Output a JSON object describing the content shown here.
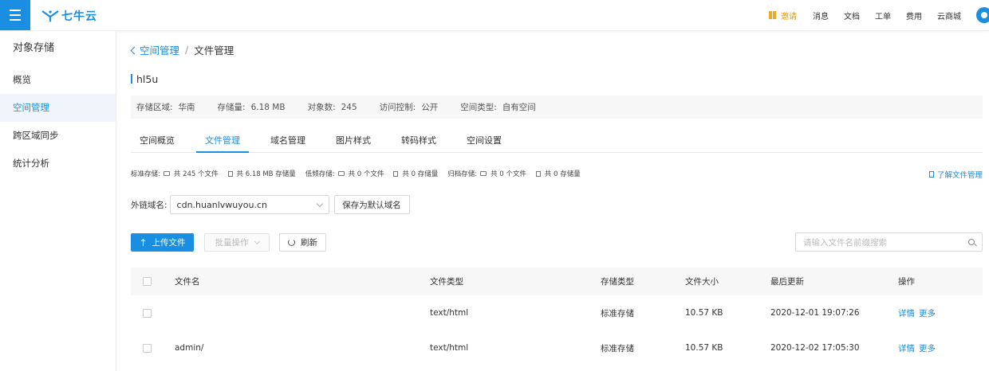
{
  "brand": {
    "logo_text": "七牛云",
    "accent": "#1a8ee0"
  },
  "topnav": {
    "invite": "邀请",
    "items": [
      "消息",
      "文档",
      "工单",
      "费用",
      "云商城"
    ]
  },
  "sidebar": {
    "title": "对象存储",
    "items": [
      {
        "label": "概览",
        "active": false
      },
      {
        "label": "空间管理",
        "active": true
      },
      {
        "label": "跨区域同步",
        "active": false
      },
      {
        "label": "统计分析",
        "active": false
      }
    ]
  },
  "breadcrumb": {
    "back": "空间管理",
    "separator": "/",
    "current": "文件管理"
  },
  "bucket": {
    "name": "hl5u",
    "info": [
      {
        "key": "存储区域:",
        "value": "华南"
      },
      {
        "key": "存储量:",
        "value": "6.18 MB"
      },
      {
        "key": "对象数:",
        "value": "245"
      },
      {
        "key": "访问控制:",
        "value": "公开"
      },
      {
        "key": "空间类型:",
        "value": "自有空间"
      }
    ]
  },
  "tabs": [
    "空间概览",
    "文件管理",
    "域名管理",
    "图片样式",
    "转码样式",
    "空间设置"
  ],
  "active_tab": "文件管理",
  "stats": [
    {
      "label": "标准存储:",
      "files": "共 245 个文件",
      "size": "共 6.18 MB 存储量"
    },
    {
      "label": "低频存储:",
      "files": "共 0 个文件",
      "size": "共 0 存储量"
    },
    {
      "label": "归档存储:",
      "files": "共 0 个文件",
      "size": "共 0 存储量"
    }
  ],
  "help_link": "了解文件管理",
  "domain": {
    "label": "外链域名:",
    "value": "cdn.huanlvwuyou.cn",
    "save_label": "保存为默认域名"
  },
  "toolbar": {
    "upload": "上传文件",
    "batch": "批量操作",
    "refresh": "刷新"
  },
  "search": {
    "placeholder": "请输入文件名前缀搜索"
  },
  "table": {
    "headers": [
      "文件名",
      "文件类型",
      "存储类型",
      "文件大小",
      "最后更新",
      "操作"
    ],
    "rows": [
      {
        "name": "",
        "type": "text/html",
        "storage": "标准存储",
        "size": "10.57 KB",
        "updated": "2020-12-01 19:07:26",
        "ops": [
          "详情",
          "更多"
        ]
      },
      {
        "name": "admin/",
        "type": "text/html",
        "storage": "标准存储",
        "size": "10.57 KB",
        "updated": "2020-12-02 17:05:30",
        "ops": [
          "详情",
          "更多"
        ]
      }
    ]
  }
}
